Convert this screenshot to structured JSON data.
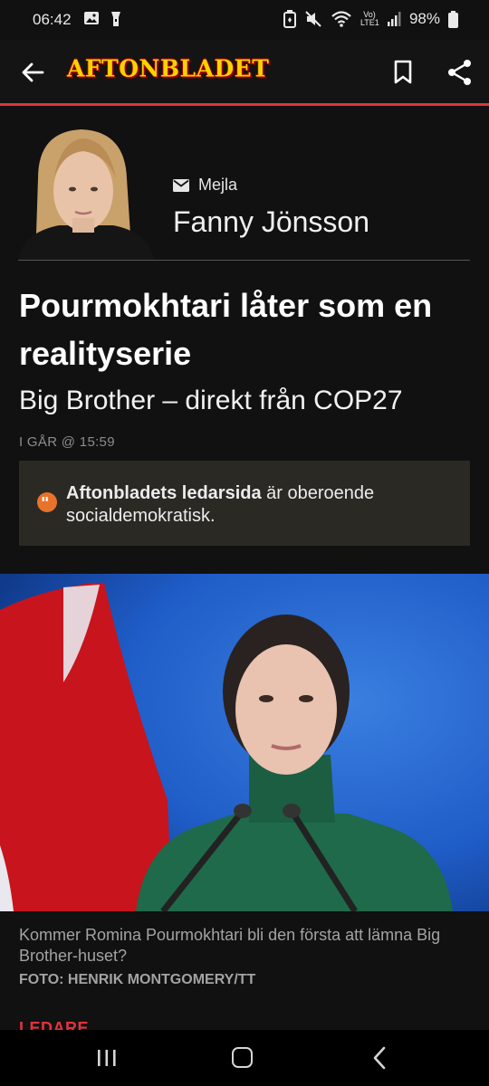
{
  "status_bar": {
    "time": "06:42",
    "battery": "98%",
    "network_label": "Vo) LTE1"
  },
  "app_bar": {
    "logo": "AFTONBLADET"
  },
  "author": {
    "email_label": "Mejla",
    "name": "Fanny Jönsson"
  },
  "article": {
    "headline": "Pourmokhtari låter som en realityserie",
    "subheadline": "Big Brother – direkt från COP27",
    "timestamp": "I GÅR @ 15:59"
  },
  "notice": {
    "bold": "Aftonbladets ledarsida",
    "rest": " är oberoende socialdemokratisk."
  },
  "image": {
    "caption": "Kommer Romina Pourmokhtari bli den första att lämna Big Brother-huset?",
    "credit": "FOTO: HENRIK MONTGOMERY/TT"
  },
  "section_label": "LEDARE",
  "colors": {
    "accent_red": "#e2333c",
    "logo_yellow": "#f5d400",
    "notice_icon": "#e8732b",
    "background": "#111111"
  }
}
